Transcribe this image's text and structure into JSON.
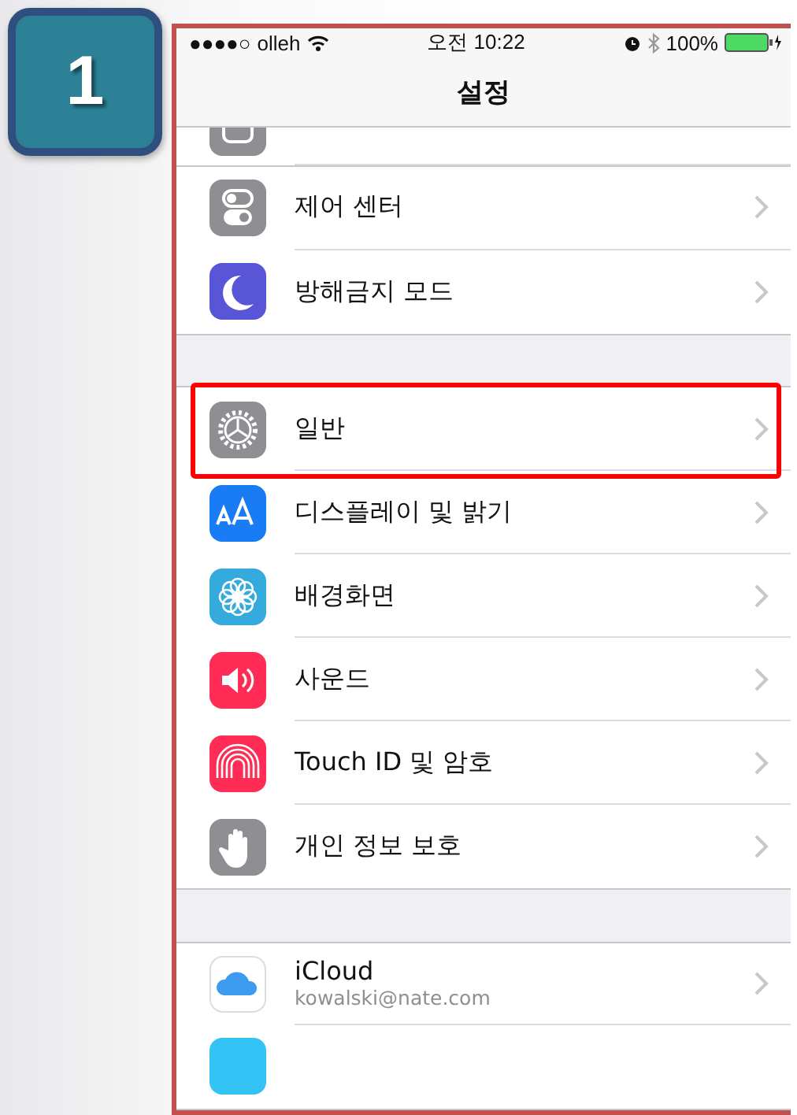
{
  "step_badge": {
    "label": "1"
  },
  "status_bar": {
    "signal": "●●●●○",
    "carrier": "olleh",
    "time": "오전 10:22",
    "battery": "100%"
  },
  "nav_bar": {
    "title": "설정"
  },
  "sections": [
    {
      "rows": [
        {
          "label": "제어 센터",
          "selected": false
        },
        {
          "label": "방해금지 모드",
          "selected": false
        }
      ]
    },
    {
      "rows": [
        {
          "label": "일반",
          "selected": true
        },
        {
          "label": "디스플레이 및 밝기",
          "selected": false
        },
        {
          "label": "배경화면",
          "selected": false
        },
        {
          "label": "사운드",
          "selected": false
        },
        {
          "label": "Touch ID 및 암호",
          "selected": false
        },
        {
          "label": "개인 정보 보호",
          "selected": false
        }
      ]
    },
    {
      "rows": [
        {
          "label": "iCloud",
          "subtitle": "kowalski@nate.com",
          "selected": false
        }
      ]
    }
  ]
}
